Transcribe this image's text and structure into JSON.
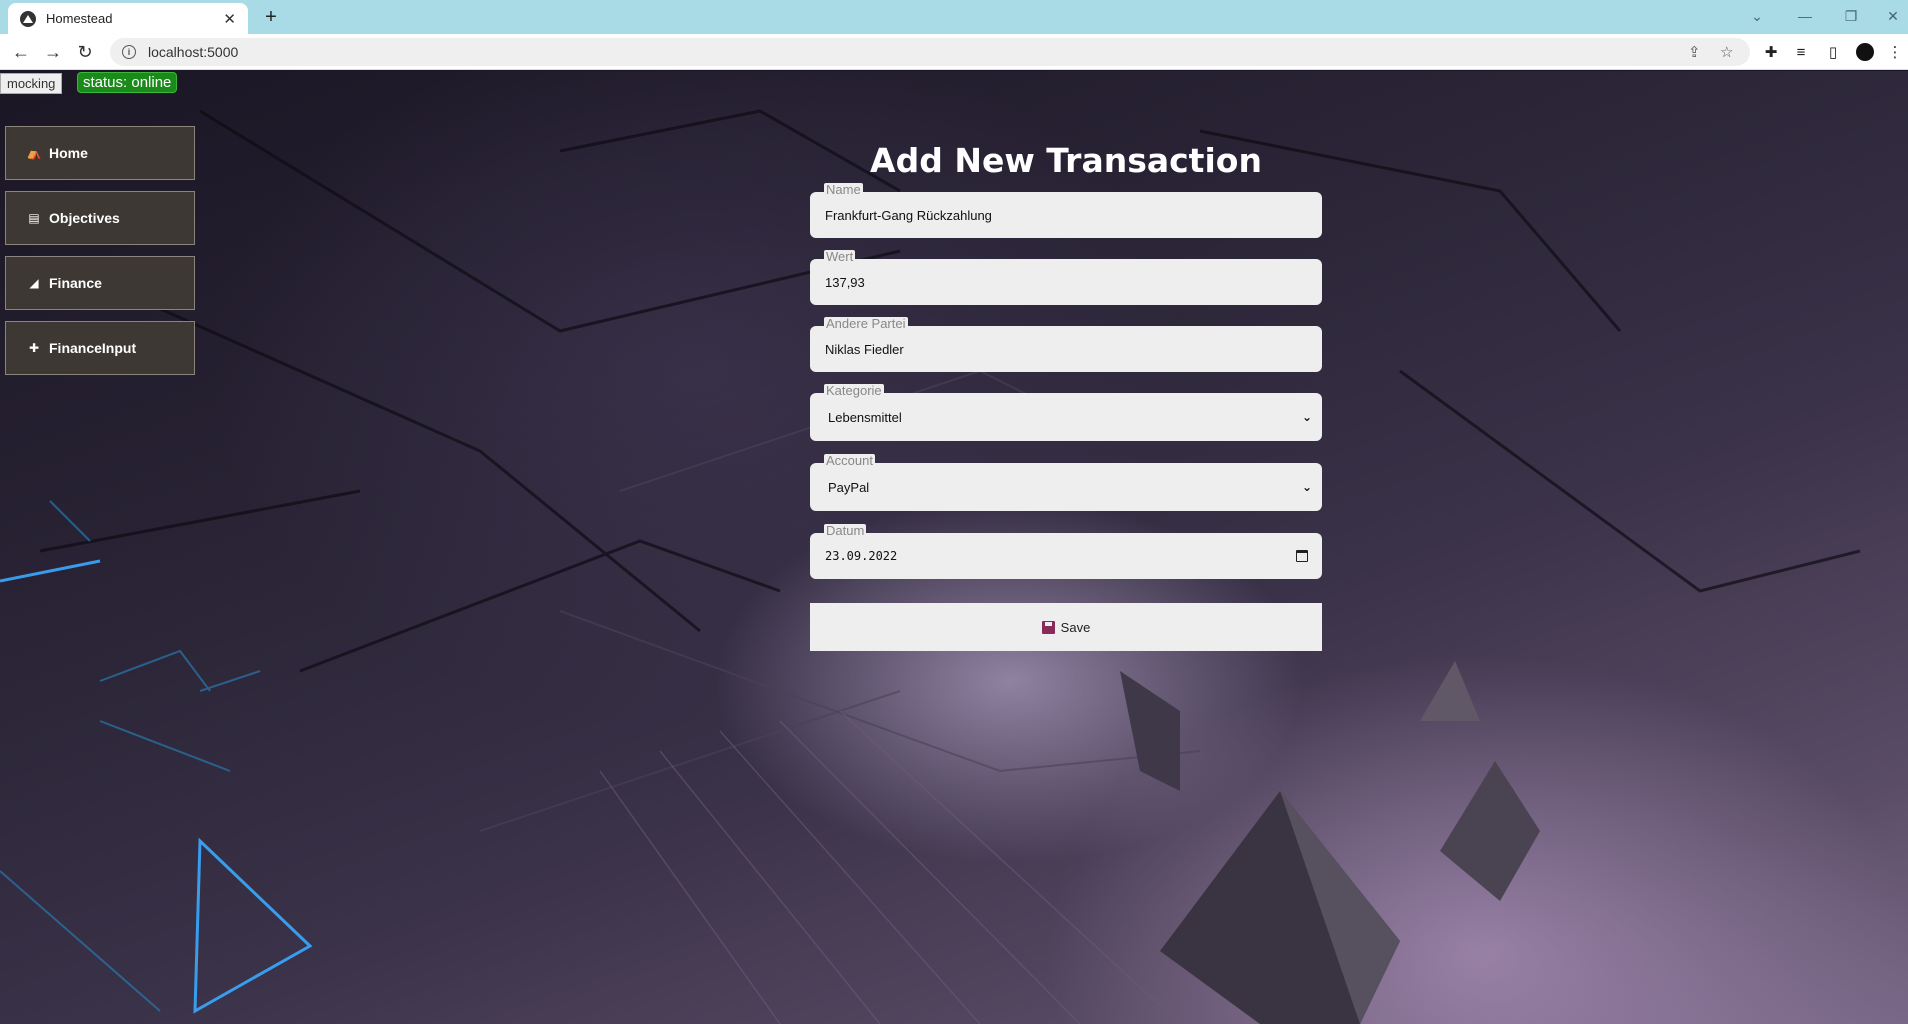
{
  "browser": {
    "tab_title": "Homestead",
    "url": "localhost:5000"
  },
  "badges": {
    "mode": "mocking",
    "status": "status: online"
  },
  "sidebar": {
    "items": [
      {
        "label": "Home",
        "icon": "home-icon"
      },
      {
        "label": "Objectives",
        "icon": "list-icon"
      },
      {
        "label": "Finance",
        "icon": "chart-icon"
      },
      {
        "label": "FinanceInput",
        "icon": "plus-icon"
      }
    ]
  },
  "form": {
    "title": "Add New Transaction",
    "name": {
      "label": "Name",
      "value": "Frankfurt-Gang Rückzahlung"
    },
    "wert": {
      "label": "Wert",
      "value": "137,93"
    },
    "partei": {
      "label": "Andere Partei",
      "value": "Niklas Fiedler"
    },
    "kategorie": {
      "label": "Kategorie",
      "value": "Lebensmittel"
    },
    "account": {
      "label": "Account",
      "value": "PayPal"
    },
    "datum": {
      "label": "Datum",
      "value": "23.09.2022"
    },
    "save_label": "Save"
  },
  "colors": {
    "status_green": "#1a8a1a",
    "sidebar_bg": "#3d3833",
    "field_bg": "#eeeeee"
  }
}
